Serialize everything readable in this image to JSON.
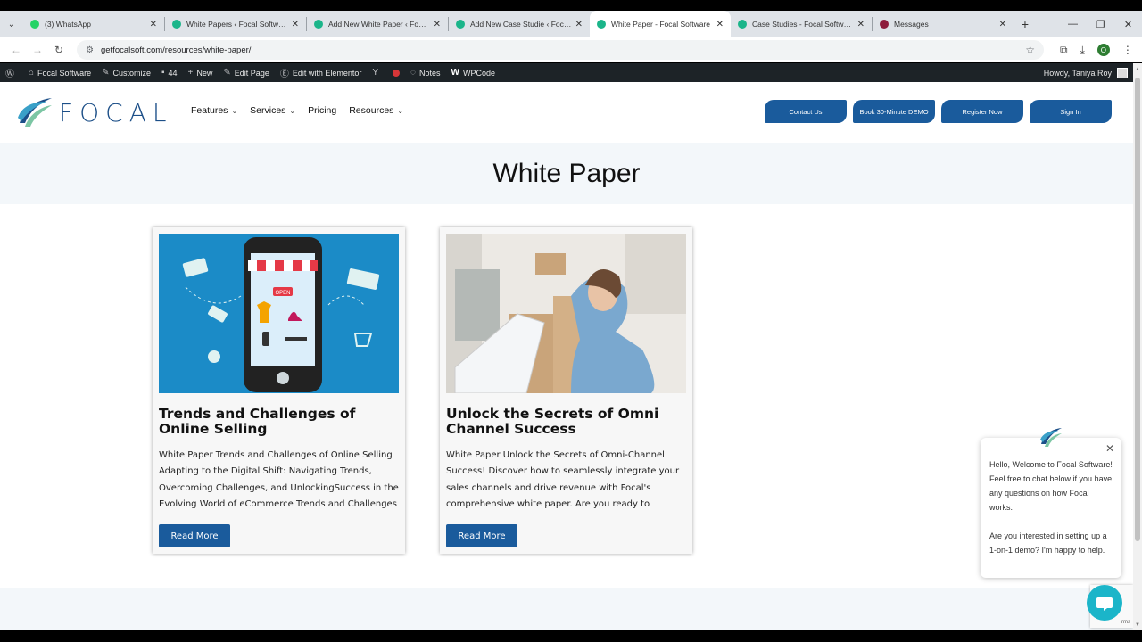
{
  "browser": {
    "tabs": [
      {
        "title": "(3) WhatsApp",
        "color": "#25d366"
      },
      {
        "title": "White Papers ‹ Focal Software —",
        "color": "#1bb58a"
      },
      {
        "title": "Add New White Paper ‹ Focal S",
        "color": "#1bb58a"
      },
      {
        "title": "Add New Case Studie ‹ Focal S",
        "color": "#1bb58a"
      },
      {
        "title": "White Paper - Focal Software",
        "color": "#1bb58a",
        "active": true
      },
      {
        "title": "Case Studies - Focal Software",
        "color": "#1bb58a"
      },
      {
        "title": "Messages",
        "color": "#8e1c3c"
      }
    ],
    "url": "getfocalsoft.com/resources/white-paper/"
  },
  "wpbar": {
    "site": "Focal Software",
    "customize": "Customize",
    "comments": "44",
    "new": "New",
    "edit_page": "Edit Page",
    "elementor": "Edit with Elementor",
    "notes": "Notes",
    "wpcode": "WPCode",
    "howdy": "Howdy, Taniya Roy"
  },
  "header": {
    "logo_text": "FOCAL",
    "nav": [
      "Features",
      "Services",
      "Pricing",
      "Resources"
    ],
    "buttons": [
      "Contact Us",
      "Book 30-Minute DEMO",
      "Register Now",
      "Sign In"
    ]
  },
  "hero": {
    "title": "White Paper"
  },
  "cards": [
    {
      "title": "Trends and Challenges of Online Selling",
      "excerpt": "White Paper Trends and Challenges of Online Selling Adapting to the Digital Shift: Navigating Trends, Overcoming Challenges, and UnlockingSuccess in the Evolving World of eCommerce Trends and Challenges of",
      "button": "Read More",
      "image_note": "OPEN"
    },
    {
      "title": "Unlock the Secrets of Omni Channel Success",
      "excerpt": "White Paper Unlock the Secrets of Omni-Channel Success! Discover how to seamlessly integrate your sales channels and drive revenue with Focal's comprehensive white paper. Are you ready to transform",
      "button": "Read More"
    }
  ],
  "chat": {
    "line1": "Hello, Welcome to Focal Software!",
    "line2": "Feel free to chat below if you have any questions on how Focal works.",
    "line3": "Are you interested in setting up a 1-on-1 demo? I'm happy to help."
  },
  "recaptcha_text": "rms"
}
